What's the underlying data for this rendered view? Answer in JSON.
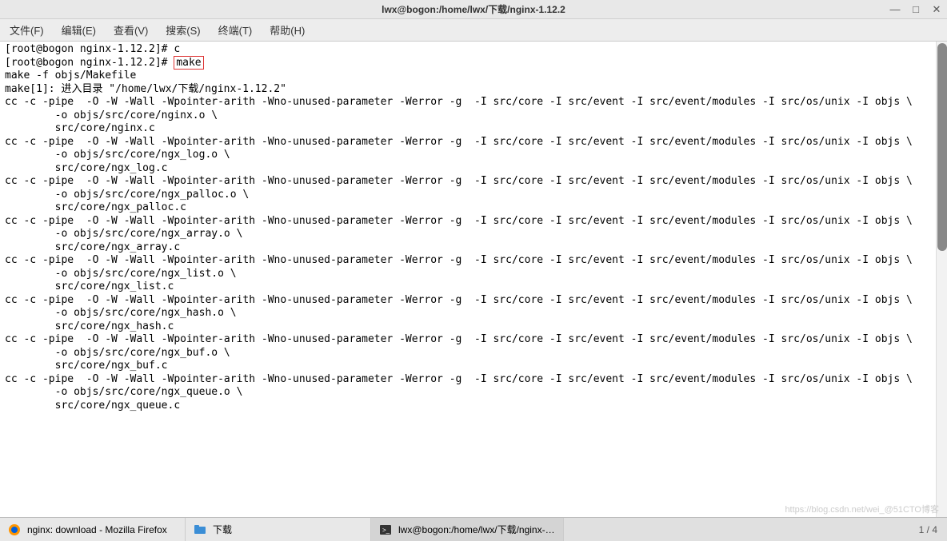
{
  "titlebar": {
    "title": "lwx@bogon:/home/lwx/下载/nginx-1.12.2"
  },
  "menubar": {
    "file": "文件(F)",
    "edit": "编辑(E)",
    "view": "查看(V)",
    "search": "搜索(S)",
    "terminal": "终端(T)",
    "help": "帮助(H)"
  },
  "terminal": {
    "prev_prompt": "[root@bogon nginx-1.12.2]# c",
    "prompt": "[root@bogon nginx-1.12.2]# ",
    "command": "make",
    "output_lines": [
      "make -f objs/Makefile",
      "make[1]: 进入目录 \"/home/lwx/下载/nginx-1.12.2\"",
      "cc -c -pipe  -O -W -Wall -Wpointer-arith -Wno-unused-parameter -Werror -g  -I src/core -I src/event -I src/event/modules -I src/os/unix -I objs \\",
      "        -o objs/src/core/nginx.o \\",
      "        src/core/nginx.c",
      "cc -c -pipe  -O -W -Wall -Wpointer-arith -Wno-unused-parameter -Werror -g  -I src/core -I src/event -I src/event/modules -I src/os/unix -I objs \\",
      "        -o objs/src/core/ngx_log.o \\",
      "        src/core/ngx_log.c",
      "cc -c -pipe  -O -W -Wall -Wpointer-arith -Wno-unused-parameter -Werror -g  -I src/core -I src/event -I src/event/modules -I src/os/unix -I objs \\",
      "        -o objs/src/core/ngx_palloc.o \\",
      "        src/core/ngx_palloc.c",
      "cc -c -pipe  -O -W -Wall -Wpointer-arith -Wno-unused-parameter -Werror -g  -I src/core -I src/event -I src/event/modules -I src/os/unix -I objs \\",
      "        -o objs/src/core/ngx_array.o \\",
      "        src/core/ngx_array.c",
      "cc -c -pipe  -O -W -Wall -Wpointer-arith -Wno-unused-parameter -Werror -g  -I src/core -I src/event -I src/event/modules -I src/os/unix -I objs \\",
      "        -o objs/src/core/ngx_list.o \\",
      "        src/core/ngx_list.c",
      "cc -c -pipe  -O -W -Wall -Wpointer-arith -Wno-unused-parameter -Werror -g  -I src/core -I src/event -I src/event/modules -I src/os/unix -I objs \\",
      "        -o objs/src/core/ngx_hash.o \\",
      "        src/core/ngx_hash.c",
      "cc -c -pipe  -O -W -Wall -Wpointer-arith -Wno-unused-parameter -Werror -g  -I src/core -I src/event -I src/event/modules -I src/os/unix -I objs \\",
      "        -o objs/src/core/ngx_buf.o \\",
      "        src/core/ngx_buf.c",
      "cc -c -pipe  -O -W -Wall -Wpointer-arith -Wno-unused-parameter -Werror -g  -I src/core -I src/event -I src/event/modules -I src/os/unix -I objs \\",
      "        -o objs/src/core/ngx_queue.o \\",
      "        src/core/ngx_queue.c"
    ]
  },
  "taskbar": {
    "firefox_label": "nginx: download - Mozilla Firefox",
    "files_label": "下载",
    "terminal_label": "lwx@bogon:/home/lwx/下载/nginx-…"
  },
  "status": {
    "workspace": "1 / 4"
  },
  "watermark": "https://blog.csdn.net/wei_@51CTO博客"
}
